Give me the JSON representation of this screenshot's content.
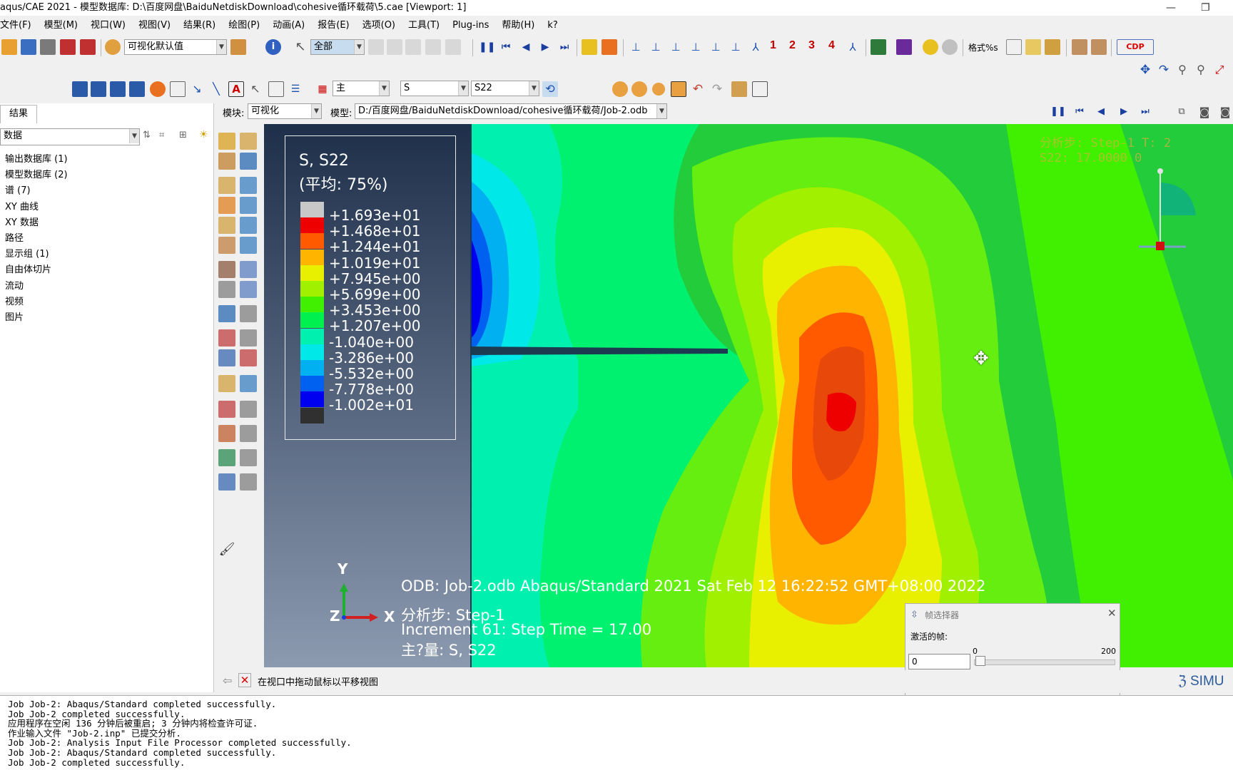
{
  "window": {
    "title": "aqus/CAE 2021 - 模型数据库: D:\\百度网盘\\BaiduNetdiskDownload\\cohesive循环载荷\\5.cae [Viewport: 1]"
  },
  "menu": [
    "文件(F)",
    "模型(M)",
    "视口(W)",
    "视图(V)",
    "结果(R)",
    "绘图(P)",
    "动画(A)",
    "报告(E)",
    "选项(O)",
    "工具(T)",
    "Plug-ins",
    "帮助(H)",
    "k?"
  ],
  "toolbar1": {
    "vis_defaults": "可视化默认值",
    "selection_filter": "全部",
    "view_numbers": [
      "1",
      "2",
      "3",
      "4"
    ],
    "format_label": "格式%s"
  },
  "toolbar2": {
    "primary_var_combo": "主",
    "field_combo": "S",
    "component_combo": "S22"
  },
  "context_bar": {
    "module_label": "模块:",
    "module_value": "可视化",
    "model_label": "模型:",
    "model_value": "D:/百度网盘/BaiduNetdiskDownload/cohesive循环载荷/Job-2.odb"
  },
  "left_panel": {
    "tab": "结果",
    "combo_value": "数据",
    "tree": [
      "输出数据库 (1)",
      "模型数据库 (2)",
      "谱 (7)",
      "XY 曲线",
      "XY 数据",
      "路径",
      "显示组 (1)",
      "自由体切片",
      "流动",
      "视频",
      "图片"
    ]
  },
  "legend": {
    "title": "S, S22",
    "subtitle": "(平均: 75%)",
    "values": [
      "+1.693e+01",
      "+1.468e+01",
      "+1.244e+01",
      "+1.019e+01",
      "+7.945e+00",
      "+5.699e+00",
      "+3.453e+00",
      "+1.207e+00",
      "-1.040e+00",
      "-3.286e+00",
      "-5.532e+00",
      "-7.778e+00",
      "-1.002e+01"
    ],
    "colors": [
      "#c8c8c8",
      "#ee0000",
      "#ff5a00",
      "#ffb400",
      "#e8f000",
      "#a0f000",
      "#40f000",
      "#00f050",
      "#00f0b0",
      "#00e8e8",
      "#00b0f0",
      "#0060f0",
      "#0000f0",
      "#303030"
    ]
  },
  "viewport": {
    "odb_line": "ODB: Job-2.odb    Abaqus/Standard 2021    Sat Feb 12 16:22:52 GMT+08:00 2022",
    "step_line": "分析步: Step-1",
    "increment_line": "Increment     61: Step Time =     17.00",
    "primary_line": "主?量: S, S22",
    "overlay_line1": "分析步: Step-1     T: 2",
    "overlay_line2": "S22: 17.0000    0",
    "triad": {
      "y": "Y",
      "z": "Z",
      "x": "X"
    },
    "brand": "SIMU"
  },
  "frame_dialog": {
    "title": "帧选择器",
    "active_frame_label": "激活的帧:",
    "frame_value": "0",
    "min": "0",
    "max": "200"
  },
  "prompt": {
    "text": "在视口中拖动鼠标以平移视图"
  },
  "messages": [
    "Job Job-2: Abaqus/Standard completed successfully.",
    "Job Job-2 completed successfully.",
    "应用程序在空闲 136 分钟后被重启; 3 分钟内将检查许可证.",
    "作业输入文件 \"Job-2.inp\" 已提交分析.",
    "Job Job-2: Analysis Input File Processor completed successfully.",
    "Job Job-2: Abaqus/Standard completed successfully.",
    "Job Job-2 completed successfully."
  ]
}
